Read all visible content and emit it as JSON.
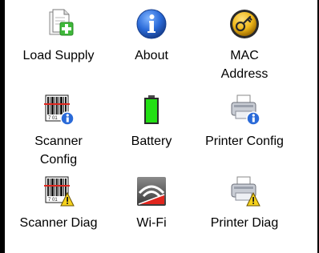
{
  "applets": [
    {
      "label": "Load Supply",
      "icon": "load-supply-icon"
    },
    {
      "label": "About",
      "icon": "info-icon"
    },
    {
      "label": "MAC\nAddress",
      "icon": "mac-address-icon"
    },
    {
      "label": "Scanner\nConfig",
      "icon": "scanner-config-icon"
    },
    {
      "label": "Battery",
      "icon": "battery-icon"
    },
    {
      "label": "Printer Config",
      "icon": "printer-config-icon"
    },
    {
      "label": "Scanner Diag",
      "icon": "scanner-diag-icon"
    },
    {
      "label": "Wi-Fi",
      "icon": "wifi-icon"
    },
    {
      "label": "Printer Diag",
      "icon": "printer-diag-icon"
    }
  ],
  "colors": {
    "background": "#ffffff",
    "frame": "#000000",
    "info_blue": "#2a6ad8",
    "battery_green": "#22e014",
    "mac_gold": "#f0b81a",
    "warning_yellow": "#f6d21c",
    "wifi_red": "#e0261e"
  }
}
